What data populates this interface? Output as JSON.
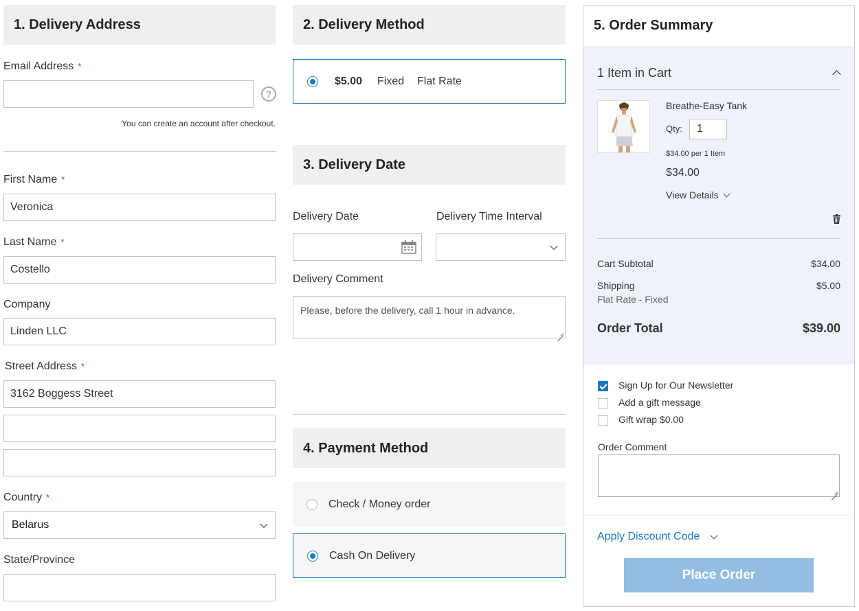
{
  "delivery_address": {
    "title": "1. Delivery Address",
    "email_label": "Email Address",
    "email_value": "",
    "email_hint": "You can create an account after checkout.",
    "first_name_label": "First Name",
    "first_name_value": "Veronica",
    "last_name_label": "Last Name",
    "last_name_value": "Costello",
    "company_label": "Company",
    "company_value": "Linden LLC",
    "street_label": "Street Address",
    "street_1": "3162 Boggess Street",
    "street_2": "",
    "street_3": "",
    "country_label": "Country",
    "country_value": "Belarus",
    "state_label": "State/Province",
    "state_value": "",
    "required_mark": "*"
  },
  "delivery_method": {
    "title": "2. Delivery Method",
    "price": "$5.00",
    "method": "Fixed",
    "carrier": "Flat Rate"
  },
  "delivery_date": {
    "title": "3. Delivery Date",
    "date_label": "Delivery Date",
    "date_value": "",
    "interval_label": "Delivery Time Interval",
    "interval_value": "",
    "comment_label": "Delivery Comment",
    "comment_value": "Please, before the delivery, call 1 hour in advance."
  },
  "payment_method": {
    "title": "4. Payment Method",
    "options": [
      {
        "label": "Check / Money order",
        "selected": false
      },
      {
        "label": "Cash On Delivery",
        "selected": true
      }
    ]
  },
  "order_summary": {
    "title": "5. Order Summary",
    "items_in_cart": "1 Item in Cart",
    "product_name": "Breathe-Easy Tank",
    "qty_label": "Qty:",
    "qty_value": "1",
    "unit_price": "$34.00 per 1 Item",
    "line_price": "$34.00",
    "view_details": "View Details",
    "subtotal_label": "Cart Subtotal",
    "subtotal_value": "$34.00",
    "shipping_label": "Shipping",
    "shipping_value": "$5.00",
    "shipping_method": "Flat Rate - Fixed",
    "total_label": "Order Total",
    "total_value": "$39.00",
    "newsletter_label": "Sign Up for Our Newsletter",
    "gift_message_label": "Add a gift message",
    "gift_wrap_label": "Gift wrap $0.00",
    "order_comment_label": "Order Comment",
    "order_comment_value": "",
    "discount_label": "Apply Discount Code",
    "place_order_label": "Place Order"
  },
  "colors": {
    "accent": "#1979c3",
    "place_order_bg": "#93bde3",
    "summary_bg": "#f0f2fb",
    "required": "#e02b27"
  }
}
